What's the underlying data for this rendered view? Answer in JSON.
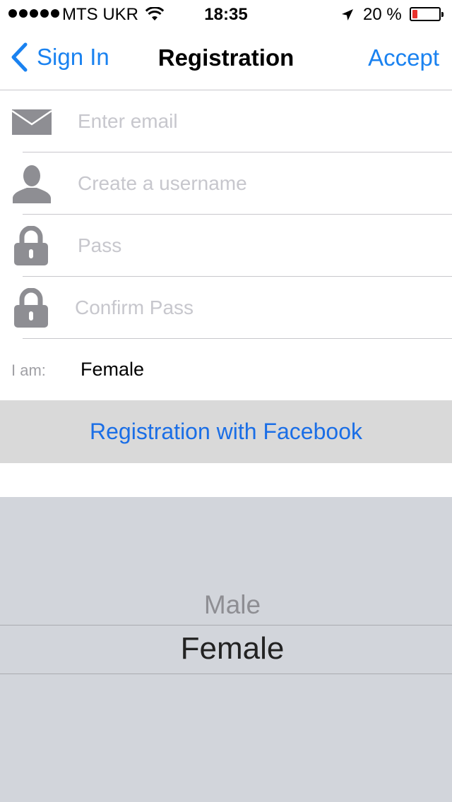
{
  "status_bar": {
    "carrier": "MTS UKR",
    "time": "18:35",
    "battery_percent": "20 %",
    "battery_level": 0.2,
    "signal_bars": 5
  },
  "nav": {
    "back_label": "Sign In",
    "title": "Registration",
    "accept_label": "Accept"
  },
  "form": {
    "email_placeholder": "Enter email",
    "username_placeholder": "Create a username",
    "pass_placeholder": "Pass",
    "confirm_placeholder": "Confirm Pass",
    "iam_label": "I am:",
    "iam_value": "Female"
  },
  "facebook_button": {
    "label": "Registration with Facebook"
  },
  "picker": {
    "options": [
      "Male",
      "Female"
    ],
    "selected": "Female"
  },
  "colors": {
    "accent": "#1a82f0",
    "icon_gray": "#8e8e93",
    "battery_low": "#e8322d",
    "picker_bg": "#d2d5db",
    "button_bg": "#d9d9d9"
  }
}
